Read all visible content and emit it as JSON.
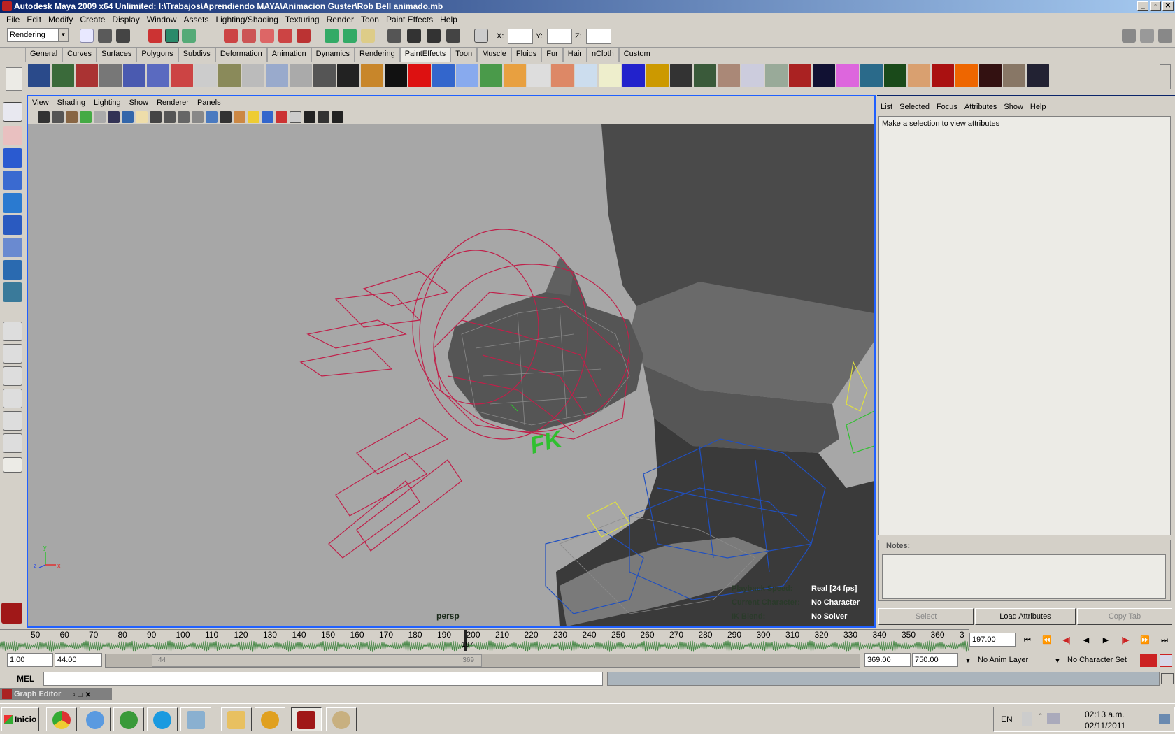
{
  "window": {
    "title": "Autodesk Maya 2009 x64 Unlimited: I:\\Trabajos\\Aprendiendo MAYA\\Animacion Guster\\Rob Bell animado.mb",
    "controls": [
      "_",
      "▫",
      "✕"
    ]
  },
  "menubar": [
    "File",
    "Edit",
    "Modify",
    "Create",
    "Display",
    "Window",
    "Assets",
    "Lighting/Shading",
    "Texturing",
    "Render",
    "Toon",
    "Paint Effects",
    "Help"
  ],
  "statusline": {
    "menuset": "Rendering",
    "x_label": "X:",
    "y_label": "Y:",
    "z_label": "Z:",
    "x_value": "",
    "y_value": "",
    "z_value": ""
  },
  "shelf_tabs": [
    "General",
    "Curves",
    "Surfaces",
    "Polygons",
    "Subdivs",
    "Deformation",
    "Animation",
    "Dynamics",
    "Rendering",
    "PaintEffects",
    "Toon",
    "Muscle",
    "Fluids",
    "Fur",
    "Hair",
    "nCloth",
    "Custom"
  ],
  "shelf_active": "PaintEffects",
  "viewport": {
    "menu": [
      "View",
      "Shading",
      "Lighting",
      "Show",
      "Renderer",
      "Panels"
    ],
    "camera": "persp",
    "axis_y": "y",
    "axis_x": "x",
    "axis_z": "z",
    "hud": [
      {
        "label": "Playback Speed:",
        "value": "Real [24 fps]"
      },
      {
        "label": "Current Character:",
        "value": "No Character"
      },
      {
        "label": "IK Blend:",
        "value": "No Solver"
      }
    ],
    "control_label": "FK"
  },
  "attribute_editor": {
    "menu": [
      "List",
      "Selected",
      "Focus",
      "Attributes",
      "Show",
      "Help"
    ],
    "message": "Make a selection to view attributes",
    "notes_label": "Notes:",
    "buttons": [
      "Select",
      "Load Attributes",
      "Copy Tab"
    ]
  },
  "timeline": {
    "ticks": [
      "50",
      "60",
      "70",
      "80",
      "90",
      "100",
      "110",
      "120",
      "130",
      "140",
      "150",
      "160",
      "170",
      "180",
      "190",
      "200",
      "210",
      "220",
      "230",
      "240",
      "250",
      "260",
      "270",
      "280",
      "290",
      "300",
      "310",
      "320",
      "330",
      "340",
      "350",
      "360",
      "3"
    ],
    "current_frame": "197.00",
    "marker": "197"
  },
  "range": {
    "start": "1.00",
    "playback_start": "44.00",
    "slider_start": "44",
    "slider_end": "369",
    "playback_end": "369.00",
    "end": "750.00",
    "anim_layer": "No Anim Layer",
    "character_set": "No Character Set"
  },
  "mel": {
    "label": "MEL",
    "command": ""
  },
  "graph_editor": {
    "title": "Graph Editor"
  },
  "taskbar": {
    "start": "Inicio",
    "language": "EN",
    "time": "02:13 a.m.",
    "date": "02/11/2011"
  },
  "colors": {
    "title_start": "#0a246a",
    "title_end": "#a6caf0",
    "viewport_border": "#2060ff",
    "scene_bg": "#a7a7a7",
    "rig_red": "#c0204a",
    "rig_blue": "#2050c0",
    "rig_green": "#30c030",
    "rig_yellow": "#e0e040"
  }
}
